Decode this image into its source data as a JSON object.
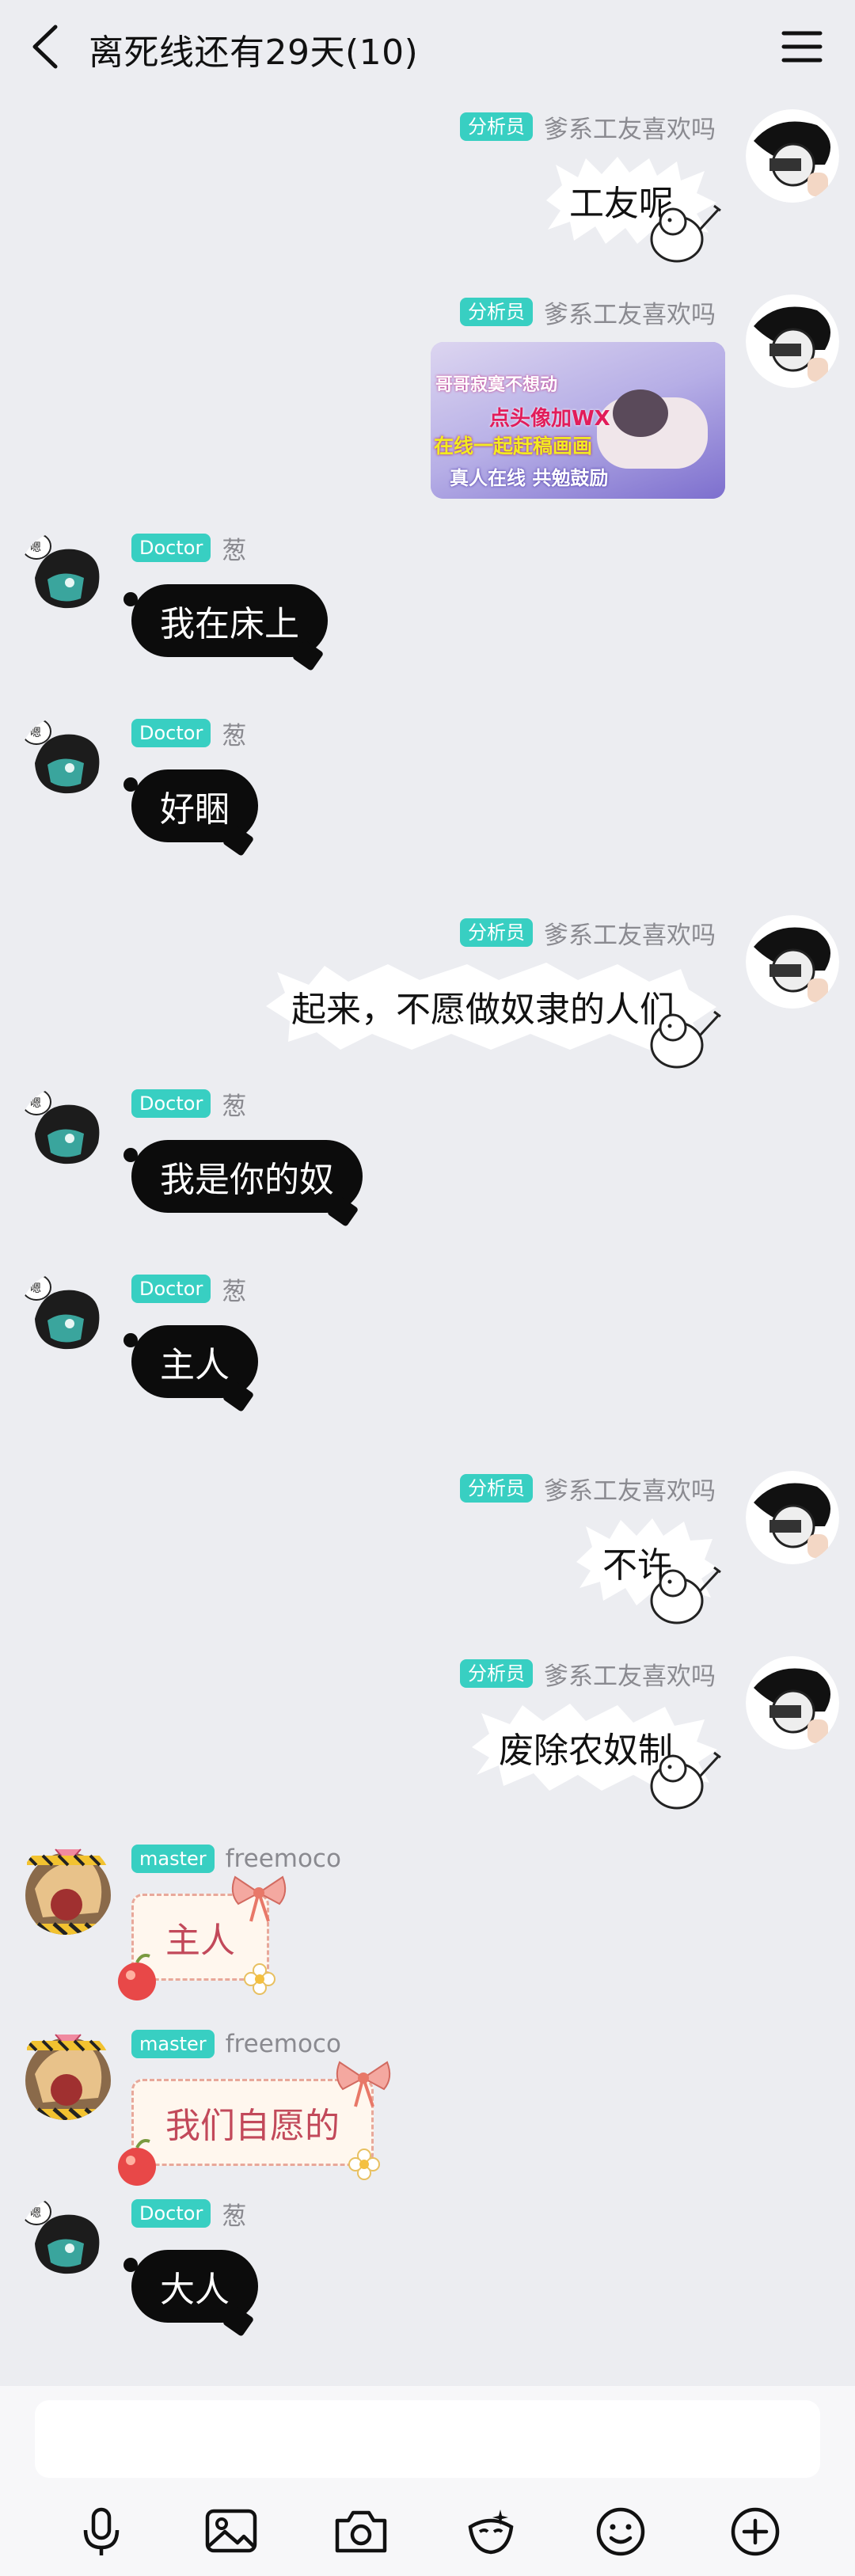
{
  "header": {
    "title": "离死线还有29天(10)"
  },
  "messages": [
    {
      "side": "right",
      "type": "spiky",
      "badge": "分析员",
      "sender": "爹系工友喜欢吗",
      "text": "工友呢"
    },
    {
      "side": "right",
      "type": "image",
      "badge": "分析员",
      "sender": "爹系工友喜欢吗",
      "image_lines": [
        "哥哥寂寞不想动",
        "点头像加WX",
        "在线一起赶稿画画",
        "真人在线  共勉鼓励"
      ]
    },
    {
      "side": "left",
      "type": "black",
      "badge": "Doctor",
      "sender": "葱",
      "text": "我在床上"
    },
    {
      "side": "left",
      "type": "black",
      "badge": "Doctor",
      "sender": "葱",
      "text": "好睏"
    },
    {
      "side": "right",
      "type": "spiky",
      "badge": "分析员",
      "sender": "爹系工友喜欢吗",
      "text": "起来，不愿做奴隶的人们"
    },
    {
      "side": "left",
      "type": "black",
      "badge": "Doctor",
      "sender": "葱",
      "text": "我是你的奴"
    },
    {
      "side": "left",
      "type": "black",
      "badge": "Doctor",
      "sender": "葱",
      "text": "主人"
    },
    {
      "side": "right",
      "type": "spiky",
      "badge": "分析员",
      "sender": "爹系工友喜欢吗",
      "text": "不许"
    },
    {
      "side": "right",
      "type": "spiky",
      "badge": "分析员",
      "sender": "爹系工友喜欢吗",
      "text": "废除农奴制"
    },
    {
      "side": "left",
      "type": "master",
      "badge": "master",
      "sender": "freemoco",
      "text": "主人"
    },
    {
      "side": "left",
      "type": "master",
      "badge": "master",
      "sender": "freemoco",
      "text": "我们自愿的"
    },
    {
      "side": "left",
      "type": "black",
      "badge": "Doctor",
      "sender": "葱",
      "text": "大人"
    }
  ],
  "input": {
    "placeholder": ""
  },
  "toolbar": [
    "microphone-icon",
    "image-icon",
    "camera-icon",
    "sticker-icon",
    "emoji-icon",
    "plus-icon"
  ],
  "colors": {
    "badge": "#38cfc2",
    "background": "#ecedf1",
    "black_bubble": "#0c0c0c",
    "master_text": "#c2495a"
  }
}
